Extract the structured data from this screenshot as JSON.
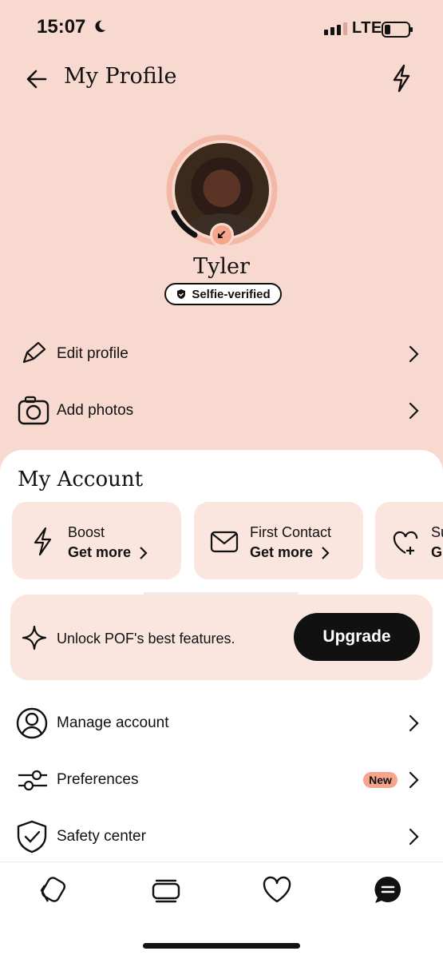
{
  "status_bar": {
    "time": "15:07",
    "network": "LTE"
  },
  "header": {
    "title": "My Profile"
  },
  "profile": {
    "name": "Tyler",
    "badge": "Selfie-verified"
  },
  "profile_actions": [
    {
      "label": "Edit profile",
      "icon": "pencil-icon"
    },
    {
      "label": "Add photos",
      "icon": "camera-icon"
    }
  ],
  "account": {
    "title": "My Account",
    "cards": [
      {
        "title": "Boost",
        "action": "Get more",
        "icon": "bolt-icon"
      },
      {
        "title": "First Contact",
        "action": "Get more",
        "icon": "envelope-icon"
      },
      {
        "title": "Su",
        "action": "G",
        "icon": "heart-plus-icon"
      }
    ],
    "upgrade": {
      "text": "Unlock POF's best features.",
      "button": "Upgrade"
    },
    "menu": [
      {
        "label": "Manage account",
        "icon": "user-circle-icon"
      },
      {
        "label": "Preferences",
        "icon": "sliders-icon",
        "badge": "New"
      },
      {
        "label": "Safety center",
        "icon": "shield-check-icon"
      }
    ]
  },
  "tabs": [
    "cards-icon",
    "stack-icon",
    "heart-icon",
    "chat-icon"
  ],
  "colors": {
    "background": "#f8d9cf",
    "card": "#fbe6df",
    "accent": "#f4a58c",
    "button": "#111111"
  }
}
